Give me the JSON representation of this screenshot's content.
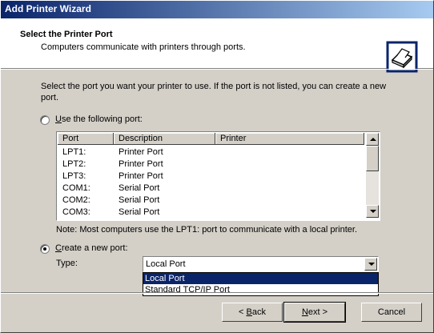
{
  "window": {
    "title": "Add Printer Wizard"
  },
  "header": {
    "title": "Select the Printer Port",
    "subtitle": "Computers communicate with printers through ports."
  },
  "intro_text": "Select the port you want your printer to use.  If the port is not listed, you can create a new port.",
  "use_port": {
    "label_prefix": "",
    "accel": "U",
    "label_rest": "se the following port:",
    "selected": false
  },
  "port_table": {
    "columns": [
      "Port",
      "Description",
      "Printer"
    ],
    "rows": [
      {
        "port": "LPT1:",
        "description": "Printer Port",
        "printer": ""
      },
      {
        "port": "LPT2:",
        "description": "Printer Port",
        "printer": ""
      },
      {
        "port": "LPT3:",
        "description": "Printer Port",
        "printer": ""
      },
      {
        "port": "COM1:",
        "description": "Serial Port",
        "printer": ""
      },
      {
        "port": "COM2:",
        "description": "Serial Port",
        "printer": ""
      },
      {
        "port": "COM3:",
        "description": "Serial Port",
        "printer": ""
      }
    ]
  },
  "note": "Note: Most computers use the LPT1: port to communicate with a local printer.",
  "create_port": {
    "accel": "C",
    "label_rest": "reate a new port:",
    "selected": true
  },
  "type": {
    "label": "Type:",
    "value": "Local Port",
    "options": [
      "Local Port",
      "Standard TCP/IP Port"
    ]
  },
  "buttons": {
    "back": {
      "prefix": "< ",
      "accel": "B",
      "rest": "ack"
    },
    "next": {
      "accel": "N",
      "rest": "ext >"
    },
    "cancel": "Cancel"
  }
}
